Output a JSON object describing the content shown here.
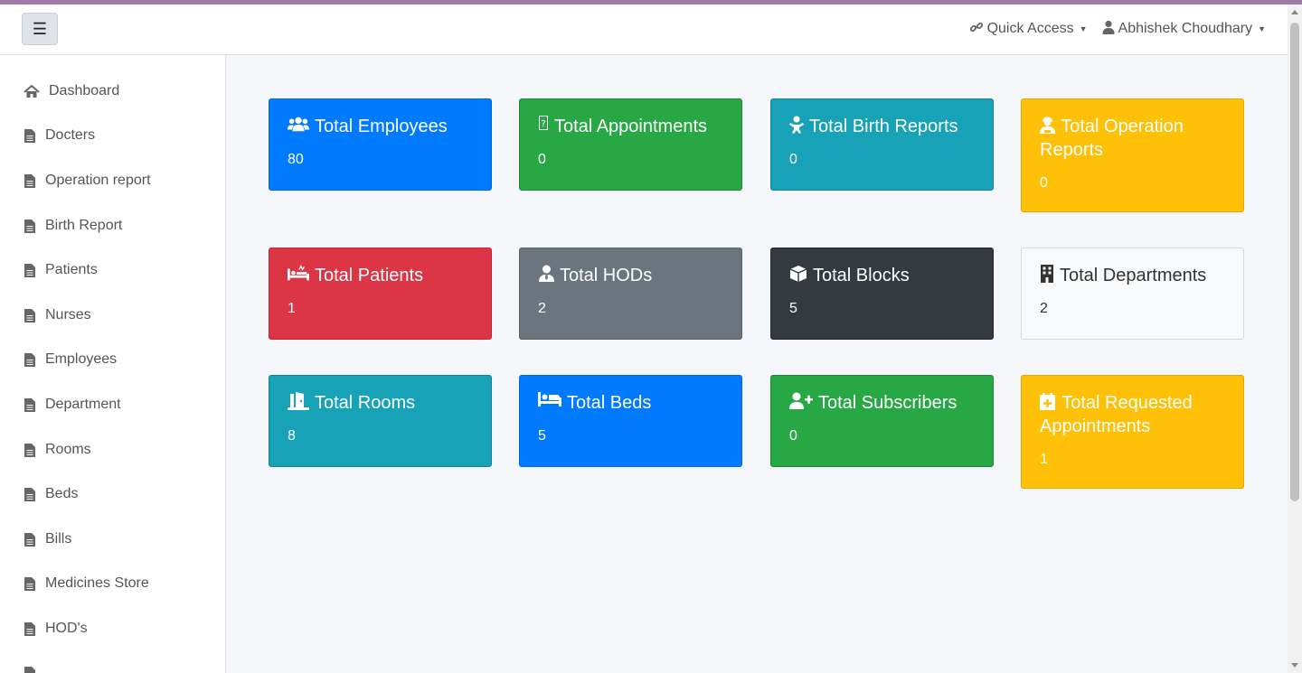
{
  "navbar": {
    "toggle_icon": "hamburger-icon",
    "quick_access": "Quick Access",
    "user_name": "Abhishek Choudhary"
  },
  "sidebar": {
    "items": [
      {
        "label": "Dashboard",
        "icon": "home-icon"
      },
      {
        "label": "Docters",
        "icon": "file-icon"
      },
      {
        "label": "Operation report",
        "icon": "file-icon"
      },
      {
        "label": "Birth Report",
        "icon": "file-icon"
      },
      {
        "label": "Patients",
        "icon": "file-icon"
      },
      {
        "label": "Nurses",
        "icon": "file-icon"
      },
      {
        "label": "Employees",
        "icon": "file-icon"
      },
      {
        "label": "Department",
        "icon": "file-icon"
      },
      {
        "label": "Rooms",
        "icon": "file-icon"
      },
      {
        "label": "Beds",
        "icon": "file-icon"
      },
      {
        "label": "Bills",
        "icon": "file-icon"
      },
      {
        "label": "Medicines Store",
        "icon": "file-icon"
      },
      {
        "label": "HOD's",
        "icon": "file-icon"
      }
    ]
  },
  "cards": [
    {
      "title": "Total Employees",
      "value": "80",
      "icon": "users-icon",
      "color": "#007bff"
    },
    {
      "title": "Total Appointments",
      "value": "0",
      "icon": "appointment-icon",
      "color": "#28a745"
    },
    {
      "title": "Total Birth Reports",
      "value": "0",
      "icon": "baby-icon",
      "color": "#17a2b8"
    },
    {
      "title": "Total Operation Reports",
      "value": "0",
      "icon": "surgeon-icon",
      "color": "#ffc107"
    },
    {
      "title": "Total Patients",
      "value": "1",
      "icon": "patient-bed-icon",
      "color": "#dc3545"
    },
    {
      "title": "Total HODs",
      "value": "2",
      "icon": "user-tie-icon",
      "color": "#6c757d"
    },
    {
      "title": "Total Blocks",
      "value": "5",
      "icon": "cube-icon",
      "color": "#343a40"
    },
    {
      "title": "Total Departments",
      "value": "2",
      "icon": "building-icon",
      "color": "#f8f9fa"
    },
    {
      "title": "Total Rooms",
      "value": "8",
      "icon": "door-icon",
      "color": "#17a2b8"
    },
    {
      "title": "Total Beds",
      "value": "5",
      "icon": "bed-icon",
      "color": "#007bff"
    },
    {
      "title": "Total Subscribers",
      "value": "0",
      "icon": "user-plus-icon",
      "color": "#28a745"
    },
    {
      "title": "Total Requested Appointments",
      "value": "1",
      "icon": "calendar-plus-icon",
      "color": "#ffc107"
    }
  ]
}
